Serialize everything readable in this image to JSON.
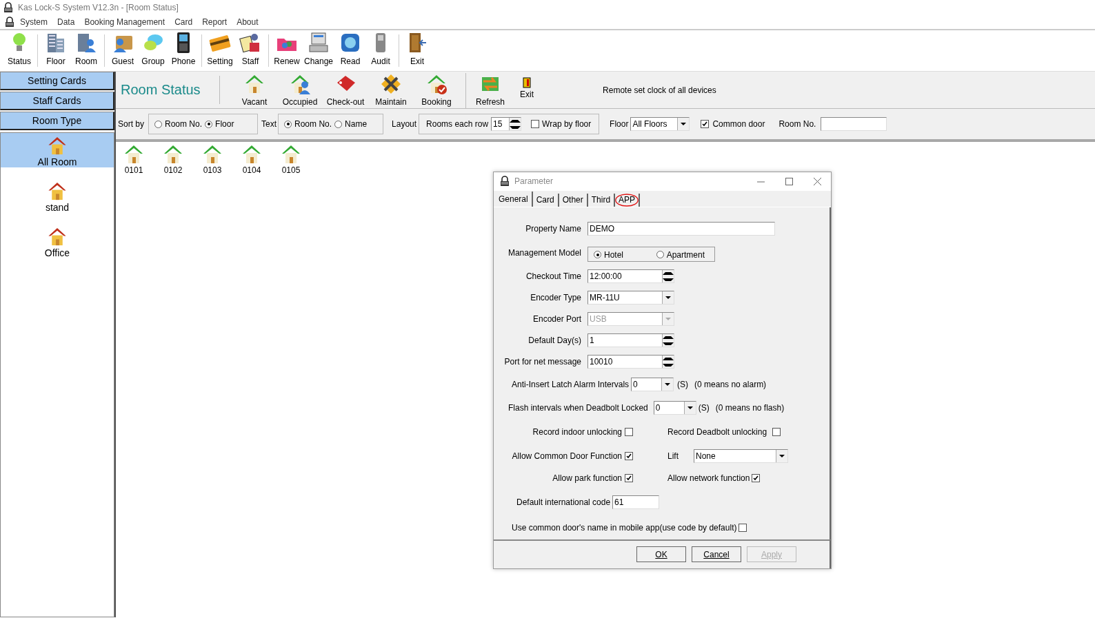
{
  "window": {
    "title": "Kas Lock-S System V12.3n - [Room Status]"
  },
  "menu": [
    "System",
    "Data",
    "Booking Management",
    "Card",
    "Report",
    "About"
  ],
  "toolbar": [
    [
      "Status"
    ],
    [
      "Floor",
      "Room"
    ],
    [
      "Guest",
      "Group",
      "Phone"
    ],
    [
      "Setting",
      "Staff"
    ],
    [
      "Renew",
      "Change",
      "Read",
      "Audit"
    ],
    [
      "Exit"
    ]
  ],
  "sidebar": {
    "buttons": [
      "Setting Cards",
      "Staff Cards",
      "Room Type"
    ],
    "room_types": [
      {
        "label": "All Room",
        "selected": true
      },
      {
        "label": "stand",
        "selected": false
      },
      {
        "label": "Office",
        "selected": false
      }
    ]
  },
  "header": {
    "title": "Room Status",
    "legend": [
      "Vacant",
      "Occupied",
      "Check-out",
      "Maintain",
      "Booking"
    ],
    "actions": [
      "Refresh",
      "Exit"
    ],
    "note": "Remote set clock of all devices"
  },
  "filters": {
    "sort_label": "Sort by",
    "sort_options": [
      {
        "label": "Room No.",
        "selected": false
      },
      {
        "label": "Floor",
        "selected": true
      }
    ],
    "text_label": "Text",
    "text_options": [
      {
        "label": "Room No.",
        "selected": true
      },
      {
        "label": "Name",
        "selected": false
      }
    ],
    "layout_label": "Layout",
    "rooms_each_row_label": "Rooms each row",
    "rooms_each_row": "15",
    "wrap_by_floor": {
      "label": "Wrap by floor",
      "checked": false
    },
    "floor_label": "Floor",
    "floor": "All Floors",
    "common_door": {
      "label": "Common door",
      "checked": true
    },
    "room_no_label": "Room No."
  },
  "rooms": [
    "0101",
    "0102",
    "0103",
    "0104",
    "0105"
  ],
  "dialog": {
    "title": "Parameter",
    "tabs": [
      {
        "label": "General",
        "selected": true
      },
      {
        "label": "Card",
        "selected": false
      },
      {
        "label": "Other",
        "selected": false
      },
      {
        "label": "Third",
        "selected": false
      },
      {
        "label": "APP",
        "selected": false,
        "circled": true
      }
    ],
    "property_name": {
      "label": "Property Name",
      "value": "DEMO"
    },
    "management_model": {
      "label": "Management Model",
      "options": [
        {
          "label": "Hotel",
          "selected": true
        },
        {
          "label": "Apartment",
          "selected": false
        }
      ]
    },
    "checkout_time": {
      "label": "Checkout Time",
      "value": "12:00:00"
    },
    "encoder_type": {
      "label": "Encoder Type",
      "value": "MR-11U"
    },
    "encoder_port": {
      "label": "Encoder Port",
      "value": "USB",
      "disabled": true
    },
    "default_days": {
      "label": "Default Day(s)",
      "value": "1"
    },
    "net_port": {
      "label": "Port for net message",
      "value": "10010"
    },
    "alarm_interval": {
      "label": "Anti-Insert Latch Alarm Intervals",
      "value": "0",
      "unit": "(S)",
      "note": "(0 means no alarm)"
    },
    "flash_interval": {
      "label": "Flash intervals when Deadbolt Locked",
      "value": "0",
      "unit": "(S)",
      "note": "(0 means no flash)"
    },
    "record_indoor": {
      "label": "Record indoor unlocking",
      "checked": false
    },
    "record_deadbolt": {
      "label": "Record Deadbolt unlocking",
      "checked": false
    },
    "common_door_function": {
      "label": "Allow Common Door Function",
      "checked": true
    },
    "lift": {
      "label": "Lift",
      "value": "None"
    },
    "park_function": {
      "label": "Allow park function",
      "checked": true
    },
    "network_function": {
      "label": "Allow network function",
      "checked": true
    },
    "intl_code": {
      "label": "Default international code",
      "value": "61"
    },
    "mobile_app_name": {
      "label": "Use common door's name in mobile app(use code by default)",
      "checked": false
    },
    "buttons": [
      {
        "label": "OK",
        "disabled": false
      },
      {
        "label": "Cancel",
        "disabled": false
      },
      {
        "label": "Apply",
        "disabled": true
      }
    ]
  }
}
